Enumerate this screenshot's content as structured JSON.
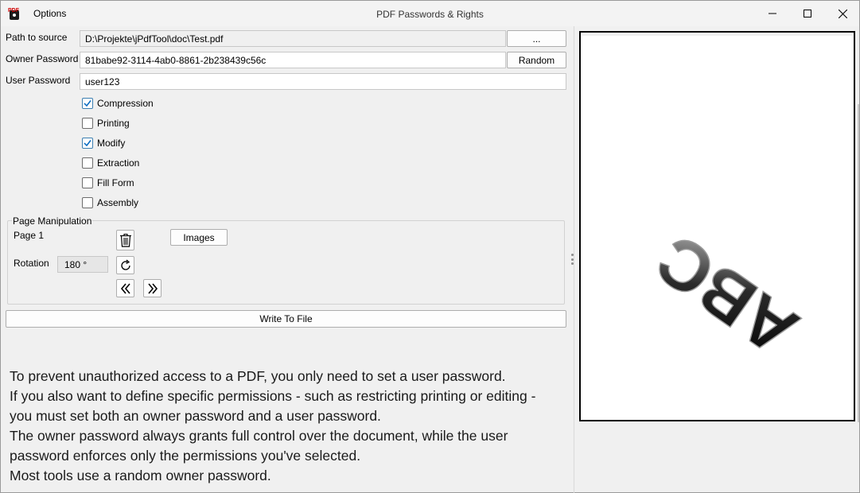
{
  "window": {
    "app_icon_text": "PDF",
    "menu_options": "Options",
    "title": "PDF Passwords & Rights"
  },
  "form": {
    "path_label": "Path to source",
    "path_value": "D:\\Projekte\\jPdfTool\\doc\\Test.pdf",
    "browse_label": "...",
    "owner_label": "Owner Password",
    "owner_value": "81babe92-3114-4ab0-8861-2b238439c56c",
    "random_label": "Random",
    "user_label": "User Password",
    "user_value": "user123"
  },
  "permissions": [
    {
      "label": "Compression",
      "checked": true
    },
    {
      "label": "Printing",
      "checked": false
    },
    {
      "label": "Modify",
      "checked": true
    },
    {
      "label": "Extraction",
      "checked": false
    },
    {
      "label": "Fill Form",
      "checked": false
    },
    {
      "label": "Assembly",
      "checked": false
    }
  ],
  "page_manipulation": {
    "title": "Page Manipulation",
    "page_label": "Page 1",
    "images_label": "Images",
    "rotation_label": "Rotation",
    "rotation_value": "180 °"
  },
  "write_label": "Write To File",
  "info_lines": [
    "To prevent unauthorized access to a PDF, you only need to set a user password.",
    "If you also want to define specific permissions - such as restricting printing or editing -",
    "you must set both an owner password and a user password.",
    "The owner password always grants full control over the document, while the user",
    "password enforces only the permissions you've selected.",
    "Most tools use a random owner password."
  ],
  "preview": {
    "text": "ABC"
  },
  "colors": {
    "checkbox_accent": "#0067c0",
    "window_bg": "#f0f0f0"
  }
}
